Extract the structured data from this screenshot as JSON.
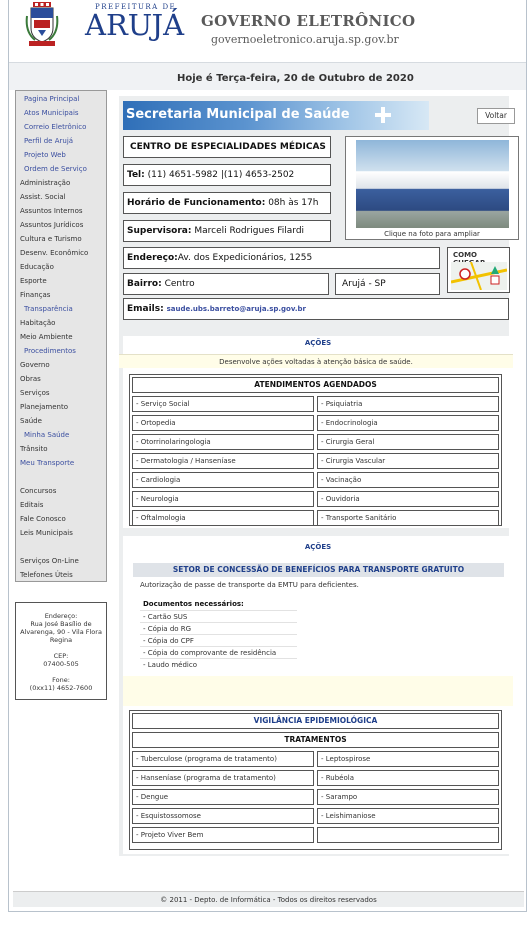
{
  "header": {
    "prefeitura": "PREFEITURA DE",
    "city": "ARUJÁ",
    "title": "GOVERNO ELETRÔNICO",
    "url": "governoeletronico.aruja.sp.gov.br",
    "date_text": "Hoje é Terça-feira, 20 de Outubro de 2020"
  },
  "menu": [
    {
      "label": "Pagina Principal",
      "style": "sub"
    },
    {
      "label": "Atos Municipais",
      "style": "sub"
    },
    {
      "label": "Correio Eletrônico",
      "style": "sub"
    },
    {
      "label": "Perfil de Arujá",
      "style": "sub"
    },
    {
      "label": "Projeto Web",
      "style": "sub"
    },
    {
      "label": "Ordem de Serviço",
      "style": "sub"
    },
    {
      "label": "Administração",
      "style": "main"
    },
    {
      "label": "Assist. Social",
      "style": "main"
    },
    {
      "label": "Assuntos Internos",
      "style": "main"
    },
    {
      "label": "Assuntos Jurídicos",
      "style": "main"
    },
    {
      "label": "Cultura e Turismo",
      "style": "main"
    },
    {
      "label": "Desenv. Econômico",
      "style": "main"
    },
    {
      "label": "Educação",
      "style": "main"
    },
    {
      "label": "Esporte",
      "style": "main"
    },
    {
      "label": "Finanças",
      "style": "main"
    },
    {
      "label": "Transparência",
      "style": "sub"
    },
    {
      "label": "Habitação",
      "style": "main"
    },
    {
      "label": "Meio Ambiente",
      "style": "main"
    },
    {
      "label": "Procedimentos",
      "style": "sub"
    },
    {
      "label": "Governo",
      "style": "main"
    },
    {
      "label": "Obras",
      "style": "main"
    },
    {
      "label": "Serviços",
      "style": "main"
    },
    {
      "label": "Planejamento",
      "style": "main"
    },
    {
      "label": "Saúde",
      "style": "main"
    },
    {
      "label": "Minha Saúde",
      "style": "sub"
    },
    {
      "label": "Trânsito",
      "style": "main"
    },
    {
      "label": "Meu Transporte",
      "style": "blue"
    },
    {
      "label": "Concursos",
      "style": "main"
    },
    {
      "label": "Editais",
      "style": "main"
    },
    {
      "label": "Fale Conosco",
      "style": "main"
    },
    {
      "label": "Leis Municipais",
      "style": "main"
    },
    {
      "label": "Serviços On-Line",
      "style": "main"
    },
    {
      "label": "Telefones Úteis",
      "style": "main"
    }
  ],
  "address": {
    "label": "Endereço:",
    "street": "Rua José Basílio de Alvarenga, 90 - Vila Flora Regina",
    "cep_label": "CEP:",
    "cep": "07400-505",
    "phone_label": "Fone:",
    "phone": "(0xx11) 4652-7600"
  },
  "secretaria": {
    "banner": "Secretaria Municipal de Saúde",
    "back_button": "Voltar",
    "unit_name": "CENTRO DE ESPECIALIDADES MÉDICAS",
    "tel_label": "Tel:",
    "tel": "(11) 4651-5982 |(11) 4653-2502",
    "hours_label": "Horário de Funcionamento:",
    "hours": "08h às 17h",
    "supervisor_label": "Supervisora:",
    "supervisor": "Marceli Rodrigues Filardi",
    "photo_caption": "Clique na foto para ampliar",
    "address_label": "Endereço:",
    "address": "Av. dos Expedicionários, 1255",
    "bairro_label": "Bairro:",
    "bairro": "Centro",
    "city": "Arujá - SP",
    "email_label": "Emails:",
    "email": "saude.ubs.barreto@aruja.sp.gov.br",
    "como_chegar": "COMO CHEGAR"
  },
  "acoes1": {
    "header": "AÇÕES",
    "description": "Desenvolve ações voltadas à atenção básica de saúde.",
    "table_title": "ATENDIMENTOS AGENDADOS",
    "rows": [
      [
        "- Serviço Social",
        "- Psiquiatria"
      ],
      [
        "- Ortopedia",
        "- Endocrinologia"
      ],
      [
        "- Otorrinolaringologia",
        "- Cirurgia Geral"
      ],
      [
        "- Dermatologia / Hanseníase",
        "- Cirurgia Vascular"
      ],
      [
        "- Cardiologia",
        "- Vacinação"
      ],
      [
        "- Neurologia",
        "- Ouvidoria"
      ],
      [
        "- Oftalmologia",
        "- Transporte Sanitário"
      ]
    ]
  },
  "acoes2": {
    "header": "AÇÕES",
    "sector_title": "SETOR DE CONCESSÃO DE BENEFÍCIOS PARA TRANSPORTE GRATUITO",
    "description": "Autorização de passe de transporte da EMTU para deficientes.",
    "docs_title": "Documentos necessários:",
    "docs": [
      "- Cartão SUS",
      "- Cópia do RG",
      "- Cópia do CPF",
      "- Cópia do comprovante de residência",
      "- Laudo médico"
    ]
  },
  "vigilancia": {
    "title": "VIGILÂNCIA EPIDEMIOLÓGICA",
    "subtitle": "TRATAMENTOS",
    "rows": [
      [
        "- Tuberculose (programa de tratamento)",
        "- Leptospirose"
      ],
      [
        "- Hanseníase (programa de tratamento)",
        "- Rubéola"
      ],
      [
        "- Dengue",
        "- Sarampo"
      ],
      [
        "- Esquistossomose",
        "- Leishimaniose"
      ],
      [
        "- Projeto Viver Bem",
        ""
      ]
    ]
  },
  "footer": "© 2011 - Depto. de Informática - Todos os direitos reservados",
  "colors": {
    "brand_blue": "#1f3f8a",
    "link_blue": "#3b4fa0",
    "banner_blue": "#2f6fb8"
  }
}
